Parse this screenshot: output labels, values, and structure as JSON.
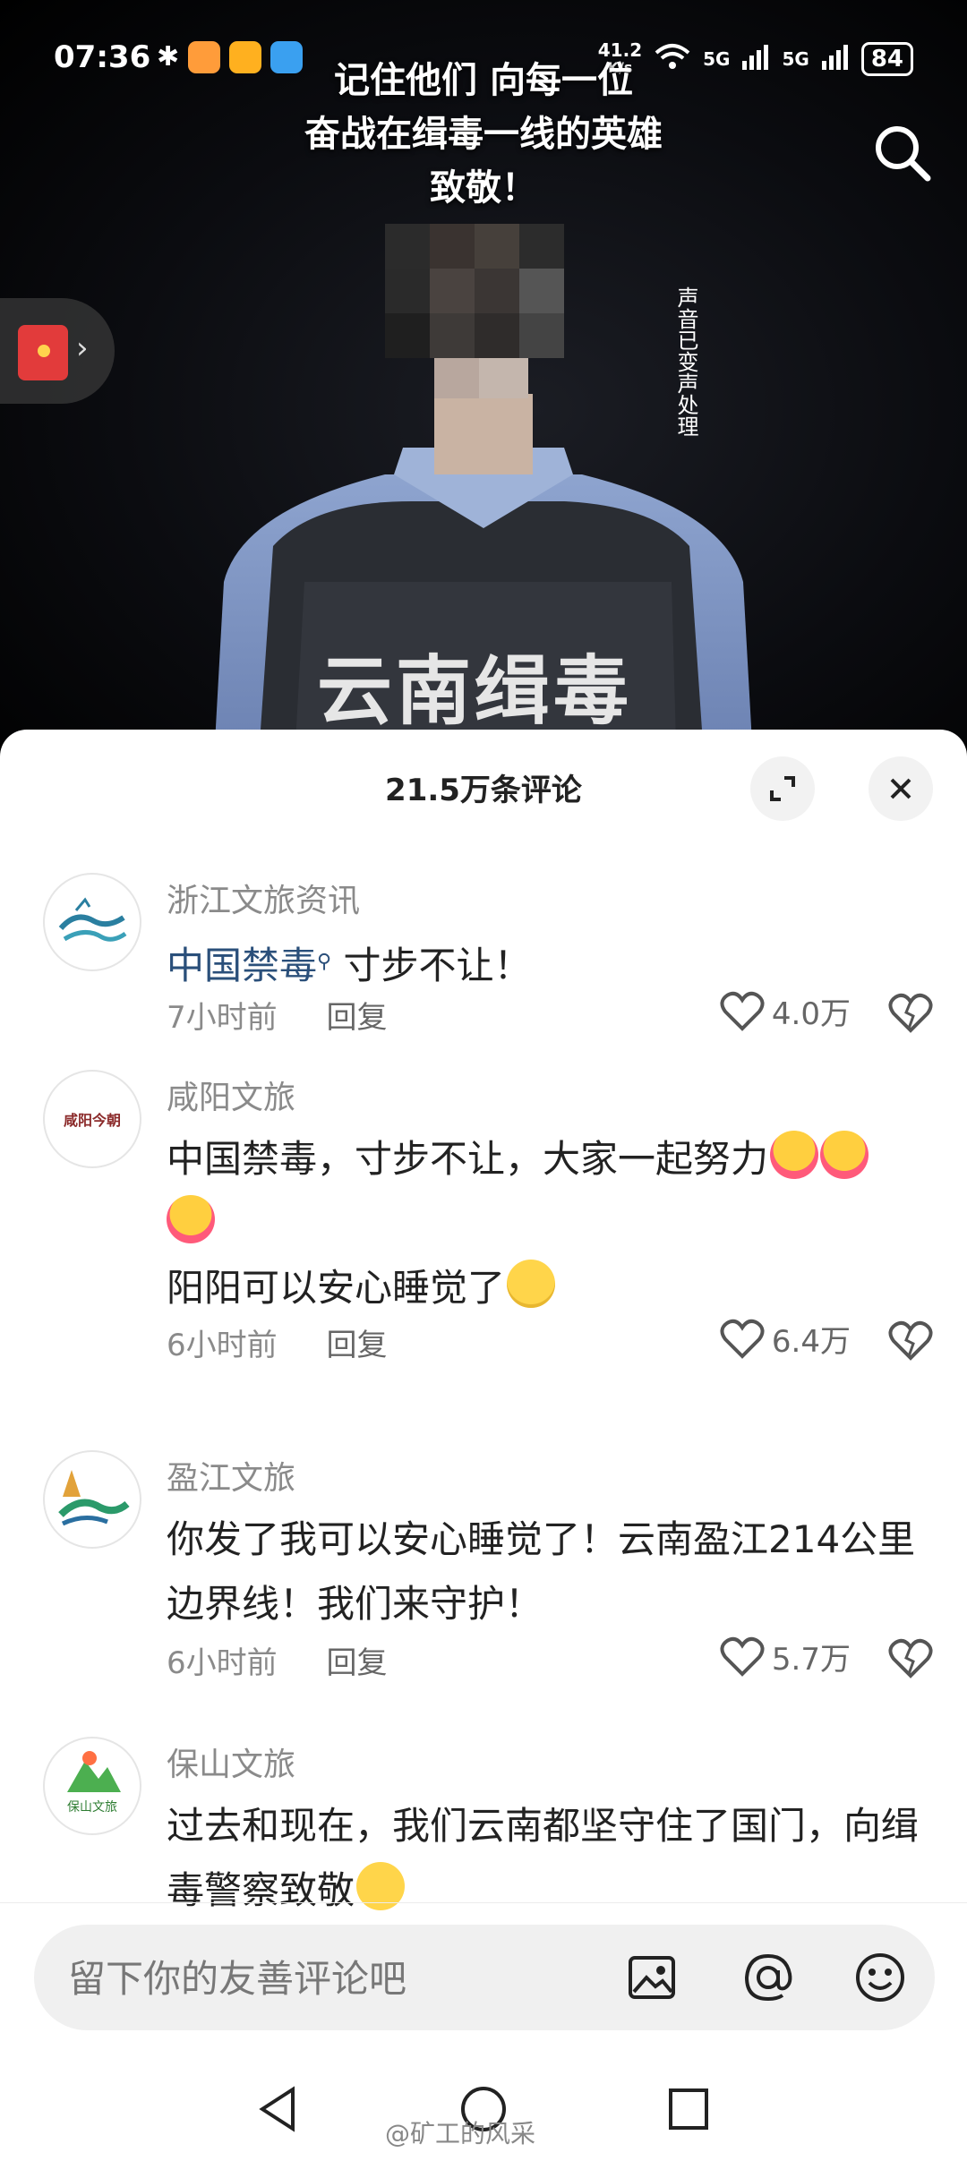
{
  "status_bar": {
    "time": "07:36",
    "net_speed_value": "41.2",
    "net_speed_unit": "K/s",
    "signal1": "5G",
    "signal2": "5G",
    "battery": "84"
  },
  "video": {
    "overlay_title": [
      "记住他们 向每一位",
      "奋战在缉毒一线的英雄",
      "致敬！"
    ],
    "voice_note": "声音已变声处理",
    "vest_text": "云南缉毒"
  },
  "sheet": {
    "title": "21.5万条评论"
  },
  "comments": [
    {
      "author": "浙江文旅资讯",
      "link": "中国禁毒",
      "text": "寸步不让！",
      "time": "7小时前",
      "reply": "回复",
      "likes": "4.0万"
    },
    {
      "author": "咸阳文旅",
      "text_line1": "中国禁毒，寸步不让，大家一起努力",
      "text_line3": "阳阳可以安心睡觉了",
      "time": "6小时前",
      "reply": "回复",
      "likes": "6.4万",
      "avatar_text": "咸阳今朝"
    },
    {
      "author": "盈江文旅",
      "text": "你发了我可以安心睡觉了！云南盈江214公里边界线！我们来守护！",
      "time": "6小时前",
      "reply": "回复",
      "likes": "5.7万"
    },
    {
      "author": "保山文旅",
      "text": "过去和现在，我们云南都坚守住了国门，向缉毒警察致敬",
      "avatar_text": "保山文旅"
    }
  ],
  "input": {
    "placeholder": "留下你的友善评论吧"
  },
  "watermark": "@矿工的风采",
  "icons": {
    "search": "search-icon",
    "expand": "expand-icon",
    "close": "close-icon",
    "like": "heart-icon",
    "dislike": "broken-heart-icon",
    "image": "image-icon",
    "at": "at-icon",
    "emoji": "emoji-icon"
  },
  "colors": {
    "link": "#2a4f7a",
    "muted": "#8a8a8a",
    "sheet_bg": "#ffffff"
  }
}
